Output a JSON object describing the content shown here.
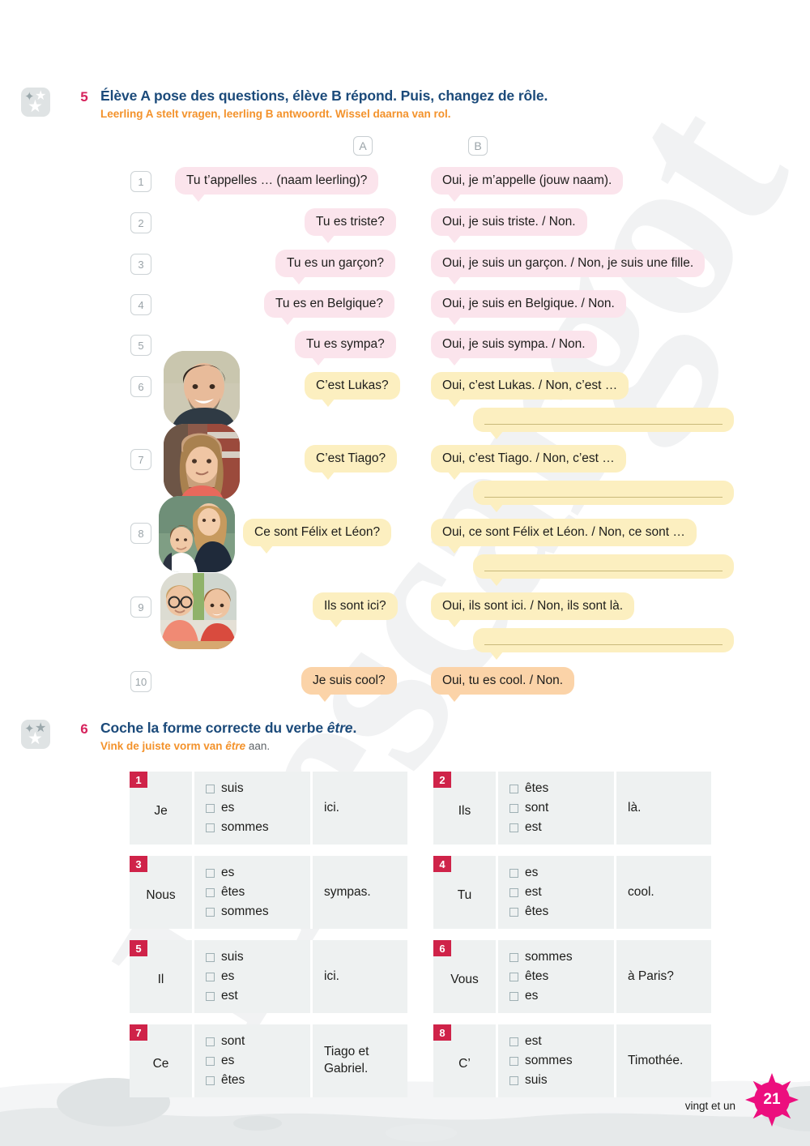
{
  "watermark_text": "L'escargot",
  "exercise5": {
    "number": "5",
    "title": "Élève A pose des questions, élève B répond. Puis, changez de rôle.",
    "subtitle": "Leerling A stelt vragen, leerling B antwoordt. Wissel daarna van rol.",
    "difficulty_icon": "one-star-icon",
    "column_a": "A",
    "column_b": "B",
    "rows": [
      {
        "num": "1",
        "question": "Tu t’appelles … (naam leerling)?",
        "answer": "Oui, je m’appelle  (jouw naam).",
        "color": "pink",
        "photo": null,
        "blank": false
      },
      {
        "num": "2",
        "question": "Tu es triste?",
        "answer": "Oui, je suis triste. / Non.",
        "color": "pink",
        "photo": null,
        "blank": false
      },
      {
        "num": "3",
        "question": "Tu es un garçon?",
        "answer": "Oui, je suis un garçon. / Non, je suis une fille.",
        "color": "pink",
        "photo": null,
        "blank": false
      },
      {
        "num": "4",
        "question": "Tu es en Belgique?",
        "answer": "Oui, je suis en Belgique. / Non.",
        "color": "pink",
        "photo": null,
        "blank": false
      },
      {
        "num": "5",
        "question": "Tu es sympa?",
        "answer": "Oui, je suis sympa. / Non.",
        "color": "pink",
        "photo": null,
        "blank": false
      },
      {
        "num": "6",
        "question": "C’est Lukas?",
        "answer": "Oui, c’est Lukas. / Non, c’est …",
        "color": "yellow",
        "photo": "photo-lukas",
        "blank": true
      },
      {
        "num": "7",
        "question": "C’est Tiago?",
        "answer": "Oui, c’est Tiago. / Non, c’est …",
        "color": "yellow",
        "photo": "photo-tiago",
        "blank": true
      },
      {
        "num": "8",
        "question": "Ce sont Félix et Léon?",
        "answer": "Oui, ce sont Félix et Léon. / Non, ce sont …",
        "color": "yellow",
        "photo": "photo-felix-leon",
        "blank": true
      },
      {
        "num": "9",
        "question": "Ils sont ici?",
        "answer": "Oui, ils sont ici. / Non, ils sont là.",
        "color": "yellow",
        "photo": "photo-two-boys",
        "blank": true
      },
      {
        "num": "10",
        "question": "Je suis cool?",
        "answer": "Oui, tu es cool. / Non.",
        "color": "orange",
        "photo": null,
        "blank": false
      }
    ]
  },
  "exercise6": {
    "number": "6",
    "title_before": "Coche la forme correcte du verbe ",
    "title_italic": "être",
    "title_after": ".",
    "sub_before": "Vink de juiste vorm van ",
    "sub_italic": "être",
    "sub_after": " aan.",
    "difficulty_icon": "two-star-icon",
    "items": [
      {
        "num": "1",
        "pronoun": "Je",
        "options": [
          "suis",
          "es",
          "sommes"
        ],
        "tail": "ici."
      },
      {
        "num": "2",
        "pronoun": "Ils",
        "options": [
          "êtes",
          "sont",
          "est"
        ],
        "tail": "là."
      },
      {
        "num": "3",
        "pronoun": "Nous",
        "options": [
          "es",
          "êtes",
          "sommes"
        ],
        "tail": "sympas."
      },
      {
        "num": "4",
        "pronoun": "Tu",
        "options": [
          "es",
          "est",
          "êtes"
        ],
        "tail": "cool."
      },
      {
        "num": "5",
        "pronoun": "Il",
        "options": [
          "suis",
          "es",
          "est"
        ],
        "tail": "ici."
      },
      {
        "num": "6",
        "pronoun": "Vous",
        "options": [
          "sommes",
          "êtes",
          "es"
        ],
        "tail": "à Paris?"
      },
      {
        "num": "7",
        "pronoun": "Ce",
        "options": [
          "sont",
          "es",
          "êtes"
        ],
        "tail": "Tiago et Gabriel."
      },
      {
        "num": "8",
        "pronoun": "C’",
        "options": [
          "est",
          "sommes",
          "suis"
        ],
        "tail": "Timothée."
      }
    ]
  },
  "footer": {
    "page_word": "vingt et un",
    "page_number": "21"
  },
  "colors": {
    "title_blue": "#1b4a7a",
    "subtitle_orange": "#f3922b",
    "exercise_number_red": "#d6225c",
    "badge_red": "#cf2349",
    "page_pink": "#ec0f7e",
    "bubble_pink": "#fbe4ec",
    "bubble_yellow": "#fcefc0",
    "bubble_orange": "#fbd3a8",
    "cell_gray": "#eef1f1"
  }
}
